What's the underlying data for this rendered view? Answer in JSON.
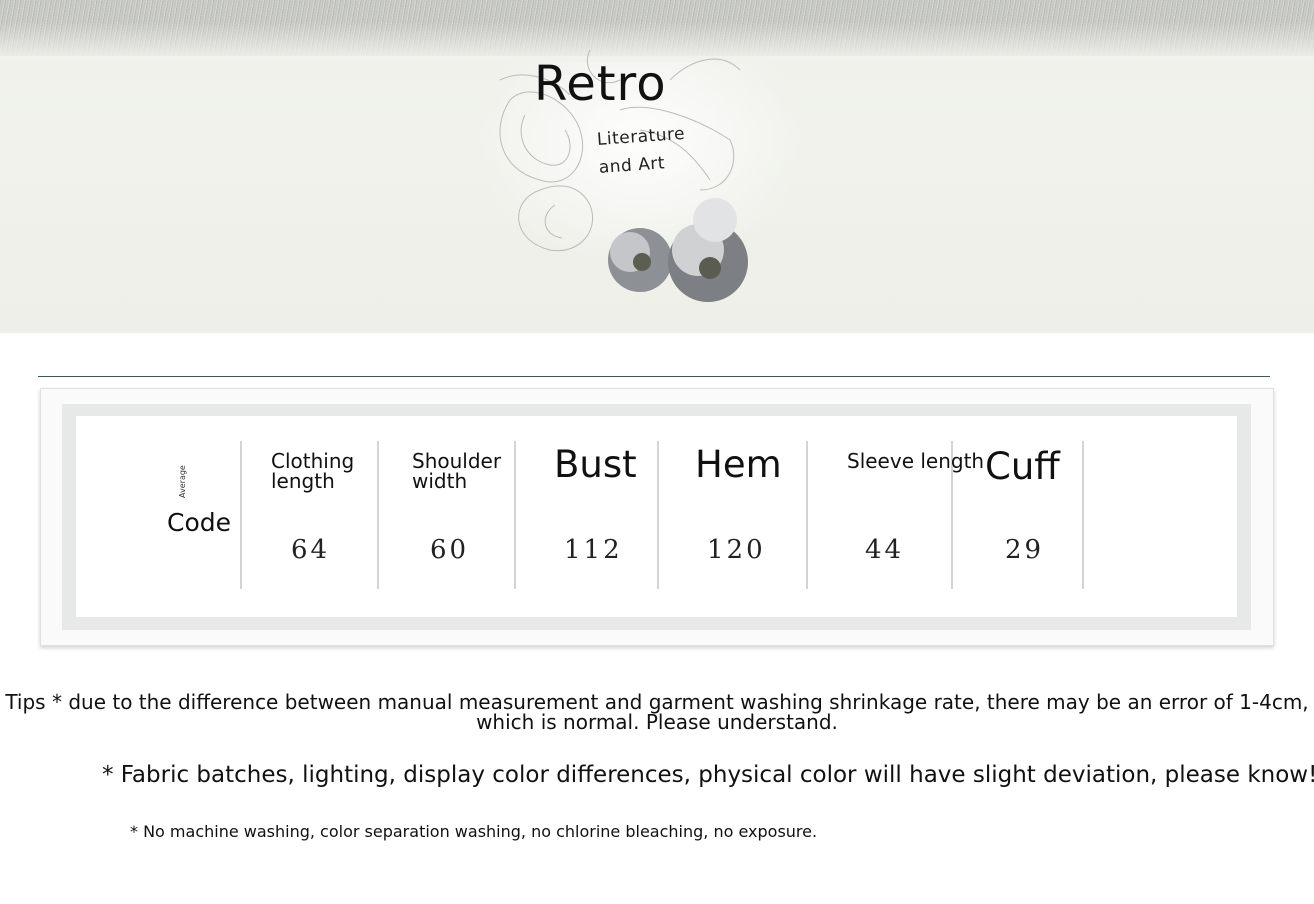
{
  "banner": {
    "title": "Retro",
    "subtitle_line1": "Literature",
    "subtitle_line2": "and Art"
  },
  "size_table": {
    "code_small": "Average",
    "code_label": "Code",
    "headers": {
      "clothing_length_1": "Clothing",
      "clothing_length_2": "length",
      "shoulder_width_1": "Shoulder",
      "shoulder_width_2": "width",
      "bust": "Bust",
      "hem": "Hem",
      "sleeve_length": "Sleeve length",
      "cuff": "Cuff"
    },
    "values": {
      "clothing_length": "64",
      "shoulder_width": "60",
      "bust": "112",
      "hem": "120",
      "sleeve_length": "44",
      "cuff": "29"
    }
  },
  "notes": {
    "tip_line1": "Tips * due to the difference between manual measurement and garment washing shrinkage rate, there may be an error of 1-4cm,",
    "tip_line2": "which is normal. Please understand.",
    "note1": "* Fabric batches, lighting, display color differences, physical color will have slight deviation, please know!",
    "note2": "* No machine washing, color separation washing, no chlorine bleaching, no exposure."
  }
}
